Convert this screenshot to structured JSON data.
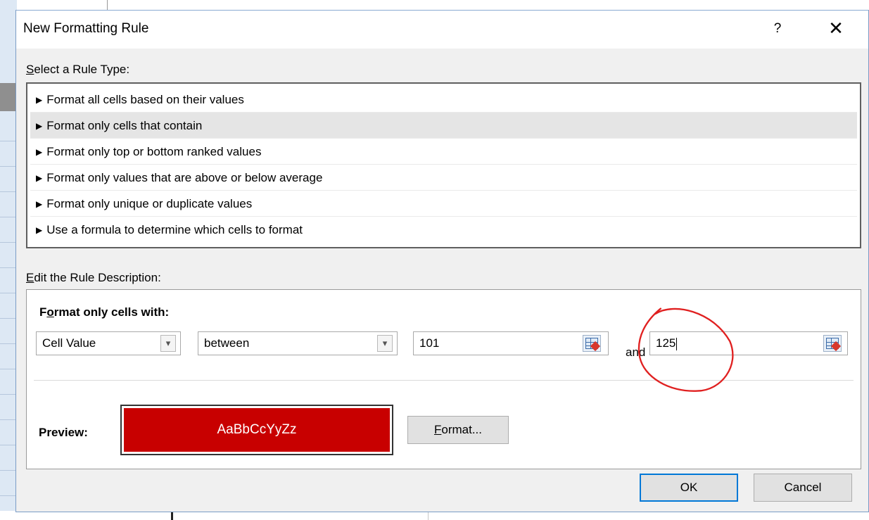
{
  "dialog": {
    "title": "New Formatting Rule",
    "help_label": "?",
    "close_label": "✕"
  },
  "rule_type": {
    "label": "Select a Rule Type:",
    "label_accesskey": "S",
    "label_rest": "elect a Rule Type:",
    "items": [
      {
        "label": "Format all cells based on their values",
        "selected": false
      },
      {
        "label": "Format only cells that contain",
        "selected": true
      },
      {
        "label": "Format only top or bottom ranked values",
        "selected": false
      },
      {
        "label": "Format only values that are above or below average",
        "selected": false
      },
      {
        "label": "Format only unique or duplicate values",
        "selected": false
      },
      {
        "label": "Use a formula to determine which cells to format",
        "selected": false
      }
    ]
  },
  "description": {
    "label_accesskey": "E",
    "label_rest": "dit the Rule Description:",
    "heading_pre": "F",
    "heading_accesskey": "o",
    "heading_post": "rmat only cells with:",
    "condition_type": "Cell Value",
    "operator": "between",
    "value1": "101",
    "and_label": "and",
    "value2": "125",
    "preview_label": "Preview:",
    "preview_text": "AaBbCcYyZz",
    "format_button_accesskey": "F",
    "format_button_rest": "ormat..."
  },
  "buttons": {
    "ok": "OK",
    "cancel": "Cancel"
  },
  "colors": {
    "preview_fill": "#c80000",
    "annotation": "#e02020",
    "default_button_border": "#0078d7"
  }
}
